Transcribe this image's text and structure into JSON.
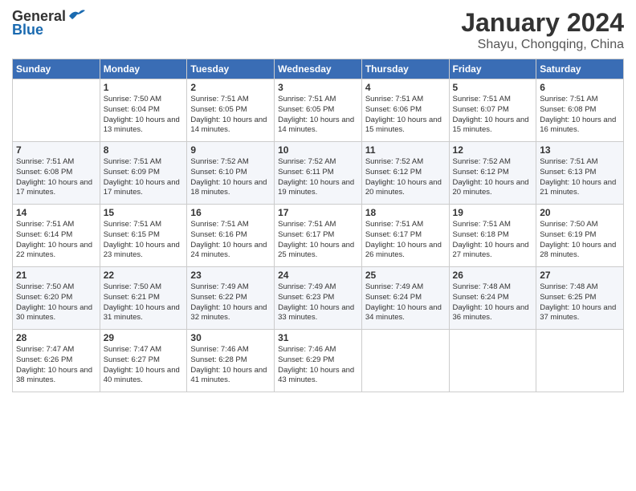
{
  "header": {
    "logo_general": "General",
    "logo_blue": "Blue",
    "month": "January 2024",
    "location": "Shayu, Chongqing, China"
  },
  "columns": [
    "Sunday",
    "Monday",
    "Tuesday",
    "Wednesday",
    "Thursday",
    "Friday",
    "Saturday"
  ],
  "weeks": [
    [
      {
        "day": "",
        "sunrise": "",
        "sunset": "",
        "daylight": ""
      },
      {
        "day": "1",
        "sunrise": "Sunrise: 7:50 AM",
        "sunset": "Sunset: 6:04 PM",
        "daylight": "Daylight: 10 hours and 13 minutes."
      },
      {
        "day": "2",
        "sunrise": "Sunrise: 7:51 AM",
        "sunset": "Sunset: 6:05 PM",
        "daylight": "Daylight: 10 hours and 14 minutes."
      },
      {
        "day": "3",
        "sunrise": "Sunrise: 7:51 AM",
        "sunset": "Sunset: 6:05 PM",
        "daylight": "Daylight: 10 hours and 14 minutes."
      },
      {
        "day": "4",
        "sunrise": "Sunrise: 7:51 AM",
        "sunset": "Sunset: 6:06 PM",
        "daylight": "Daylight: 10 hours and 15 minutes."
      },
      {
        "day": "5",
        "sunrise": "Sunrise: 7:51 AM",
        "sunset": "Sunset: 6:07 PM",
        "daylight": "Daylight: 10 hours and 15 minutes."
      },
      {
        "day": "6",
        "sunrise": "Sunrise: 7:51 AM",
        "sunset": "Sunset: 6:08 PM",
        "daylight": "Daylight: 10 hours and 16 minutes."
      }
    ],
    [
      {
        "day": "7",
        "sunrise": "Sunrise: 7:51 AM",
        "sunset": "Sunset: 6:08 PM",
        "daylight": "Daylight: 10 hours and 17 minutes."
      },
      {
        "day": "8",
        "sunrise": "Sunrise: 7:51 AM",
        "sunset": "Sunset: 6:09 PM",
        "daylight": "Daylight: 10 hours and 17 minutes."
      },
      {
        "day": "9",
        "sunrise": "Sunrise: 7:52 AM",
        "sunset": "Sunset: 6:10 PM",
        "daylight": "Daylight: 10 hours and 18 minutes."
      },
      {
        "day": "10",
        "sunrise": "Sunrise: 7:52 AM",
        "sunset": "Sunset: 6:11 PM",
        "daylight": "Daylight: 10 hours and 19 minutes."
      },
      {
        "day": "11",
        "sunrise": "Sunrise: 7:52 AM",
        "sunset": "Sunset: 6:12 PM",
        "daylight": "Daylight: 10 hours and 20 minutes."
      },
      {
        "day": "12",
        "sunrise": "Sunrise: 7:52 AM",
        "sunset": "Sunset: 6:12 PM",
        "daylight": "Daylight: 10 hours and 20 minutes."
      },
      {
        "day": "13",
        "sunrise": "Sunrise: 7:51 AM",
        "sunset": "Sunset: 6:13 PM",
        "daylight": "Daylight: 10 hours and 21 minutes."
      }
    ],
    [
      {
        "day": "14",
        "sunrise": "Sunrise: 7:51 AM",
        "sunset": "Sunset: 6:14 PM",
        "daylight": "Daylight: 10 hours and 22 minutes."
      },
      {
        "day": "15",
        "sunrise": "Sunrise: 7:51 AM",
        "sunset": "Sunset: 6:15 PM",
        "daylight": "Daylight: 10 hours and 23 minutes."
      },
      {
        "day": "16",
        "sunrise": "Sunrise: 7:51 AM",
        "sunset": "Sunset: 6:16 PM",
        "daylight": "Daylight: 10 hours and 24 minutes."
      },
      {
        "day": "17",
        "sunrise": "Sunrise: 7:51 AM",
        "sunset": "Sunset: 6:17 PM",
        "daylight": "Daylight: 10 hours and 25 minutes."
      },
      {
        "day": "18",
        "sunrise": "Sunrise: 7:51 AM",
        "sunset": "Sunset: 6:17 PM",
        "daylight": "Daylight: 10 hours and 26 minutes."
      },
      {
        "day": "19",
        "sunrise": "Sunrise: 7:51 AM",
        "sunset": "Sunset: 6:18 PM",
        "daylight": "Daylight: 10 hours and 27 minutes."
      },
      {
        "day": "20",
        "sunrise": "Sunrise: 7:50 AM",
        "sunset": "Sunset: 6:19 PM",
        "daylight": "Daylight: 10 hours and 28 minutes."
      }
    ],
    [
      {
        "day": "21",
        "sunrise": "Sunrise: 7:50 AM",
        "sunset": "Sunset: 6:20 PM",
        "daylight": "Daylight: 10 hours and 30 minutes."
      },
      {
        "day": "22",
        "sunrise": "Sunrise: 7:50 AM",
        "sunset": "Sunset: 6:21 PM",
        "daylight": "Daylight: 10 hours and 31 minutes."
      },
      {
        "day": "23",
        "sunrise": "Sunrise: 7:49 AM",
        "sunset": "Sunset: 6:22 PM",
        "daylight": "Daylight: 10 hours and 32 minutes."
      },
      {
        "day": "24",
        "sunrise": "Sunrise: 7:49 AM",
        "sunset": "Sunset: 6:23 PM",
        "daylight": "Daylight: 10 hours and 33 minutes."
      },
      {
        "day": "25",
        "sunrise": "Sunrise: 7:49 AM",
        "sunset": "Sunset: 6:24 PM",
        "daylight": "Daylight: 10 hours and 34 minutes."
      },
      {
        "day": "26",
        "sunrise": "Sunrise: 7:48 AM",
        "sunset": "Sunset: 6:24 PM",
        "daylight": "Daylight: 10 hours and 36 minutes."
      },
      {
        "day": "27",
        "sunrise": "Sunrise: 7:48 AM",
        "sunset": "Sunset: 6:25 PM",
        "daylight": "Daylight: 10 hours and 37 minutes."
      }
    ],
    [
      {
        "day": "28",
        "sunrise": "Sunrise: 7:47 AM",
        "sunset": "Sunset: 6:26 PM",
        "daylight": "Daylight: 10 hours and 38 minutes."
      },
      {
        "day": "29",
        "sunrise": "Sunrise: 7:47 AM",
        "sunset": "Sunset: 6:27 PM",
        "daylight": "Daylight: 10 hours and 40 minutes."
      },
      {
        "day": "30",
        "sunrise": "Sunrise: 7:46 AM",
        "sunset": "Sunset: 6:28 PM",
        "daylight": "Daylight: 10 hours and 41 minutes."
      },
      {
        "day": "31",
        "sunrise": "Sunrise: 7:46 AM",
        "sunset": "Sunset: 6:29 PM",
        "daylight": "Daylight: 10 hours and 43 minutes."
      },
      {
        "day": "",
        "sunrise": "",
        "sunset": "",
        "daylight": ""
      },
      {
        "day": "",
        "sunrise": "",
        "sunset": "",
        "daylight": ""
      },
      {
        "day": "",
        "sunrise": "",
        "sunset": "",
        "daylight": ""
      }
    ]
  ]
}
